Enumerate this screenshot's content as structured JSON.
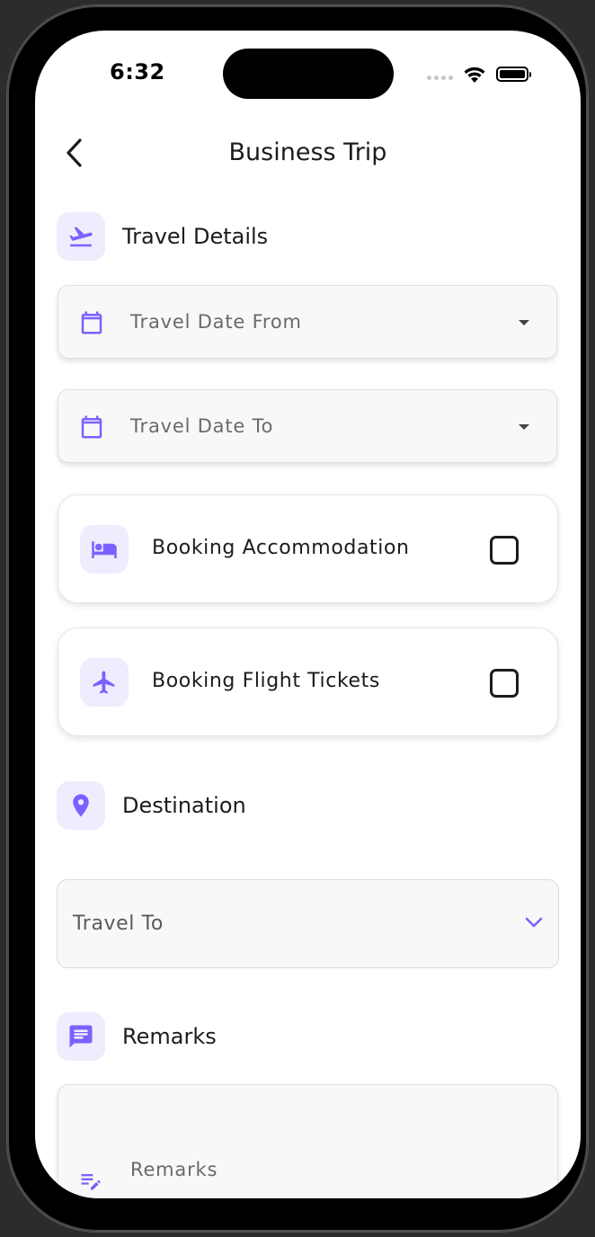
{
  "status_bar": {
    "time": "6:32"
  },
  "header": {
    "title": "Business Trip"
  },
  "travel_details": {
    "title": "Travel Details",
    "date_from_label": "Travel Date From",
    "date_to_label": "Travel Date To",
    "accommodation_label": "Booking Accommodation",
    "flight_label": "Booking Flight Tickets"
  },
  "destination": {
    "title": "Destination",
    "travel_to_label": "Travel To"
  },
  "remarks": {
    "title": "Remarks",
    "field_label": "Remarks"
  },
  "colors": {
    "accent": "#7b61ff",
    "icon_bg": "#efecfe",
    "text": "#1c1c1e",
    "muted": "#6a6a6e"
  }
}
